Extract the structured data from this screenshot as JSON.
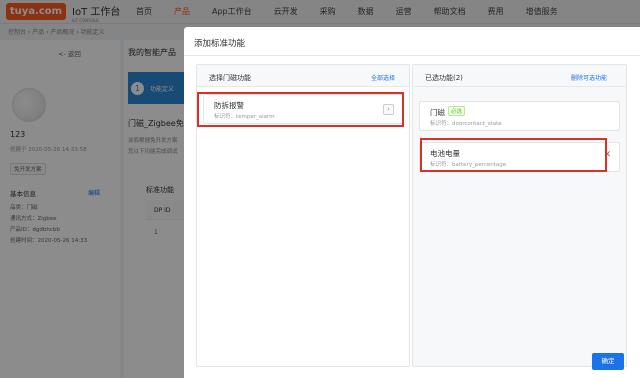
{
  "header": {
    "logo_text": "tuya.com",
    "brand_title": "IoT 工作台",
    "brand_sub": "IoT CONSOLE",
    "menu": [
      "首页",
      "产品",
      "App工作台",
      "云开发",
      "采购",
      "数据",
      "运营",
      "帮助文档",
      "费用",
      "增值服务"
    ],
    "active_menu": "产品"
  },
  "breadcrumb": "控制台 › 产品 › 产品概况 › 功能定义",
  "background": {
    "back_label": "<- 返回",
    "device_name": "123",
    "created": "创建于 2020-05-26 14:33:58",
    "tag": "免开发方案",
    "info_title": "基本信息",
    "info_edit": "编辑",
    "info_rows": [
      "品类：门磁",
      "通讯方式：Zigbee",
      "产品ID：dgdbhcbb",
      "创建时间：2020-05-26 14:33"
    ],
    "page_title": "我的智能产品",
    "step_number": "1",
    "step_label": "功能定义",
    "heading": "门磁_Zigbee免",
    "desc_lines": [
      "涂鸦根据免开发方案",
      "您以下功能完成调试"
    ],
    "standard_label": "标准功能",
    "dp_header": "DP ID",
    "dp_value": "1"
  },
  "modal": {
    "title": "添加标准功能",
    "left": {
      "header": "选择门磁功能",
      "action": "全部选择",
      "items": [
        {
          "name": "防拆报警",
          "id": "标识符：temper_alarm"
        }
      ]
    },
    "right": {
      "header": "已选功能(2)",
      "action": "删除可选功能",
      "items": [
        {
          "name": "门磁",
          "badge": "必选",
          "id": "标识符：doorcontact_state"
        },
        {
          "name": "电池电量",
          "id": "标识符：battery_percentage"
        }
      ]
    },
    "confirm": "确定"
  },
  "colors": {
    "brand": "#ff5a1f",
    "primary": "#1a73e8",
    "highlight": "#d9302a",
    "required_badge": "#52c41a"
  }
}
